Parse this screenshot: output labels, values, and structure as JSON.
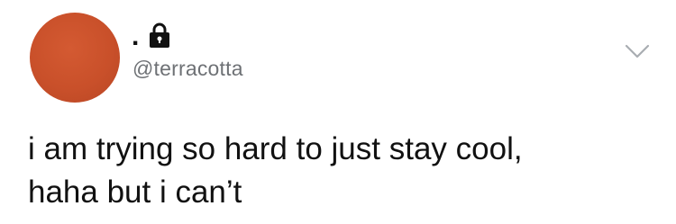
{
  "tweet": {
    "author": {
      "display_name": ".",
      "handle": "@terracotta",
      "avatar_color": "#c9502a",
      "locked_icon": "lock-icon"
    },
    "menu_icon": "chevron-down-icon",
    "text_lines": [
      "i am trying so hard to just stay cool,",
      "haha but i can’t"
    ]
  }
}
